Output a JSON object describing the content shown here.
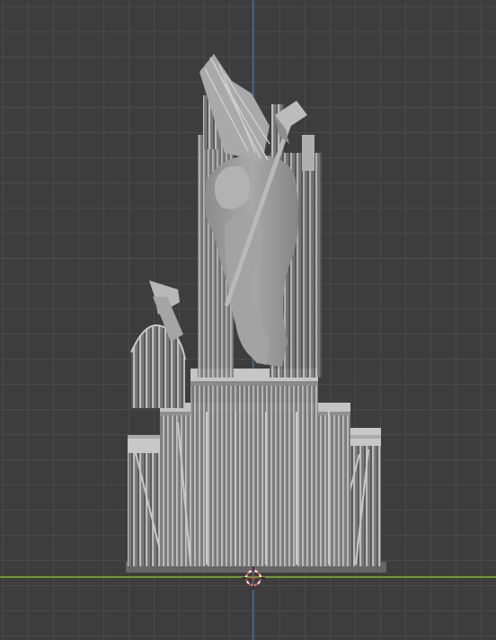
{
  "viewport": {
    "background_color": "#3d3d3d",
    "grid_color": "#4a4a4a",
    "axis_colors": {
      "y_axis": "#4f7fc6",
      "x_axis": "#6f9a2e"
    }
  },
  "scene": {
    "object": "sculpture-with-support-structures",
    "material_color": "#9a9a9a",
    "support_color": "#b5b5b5"
  },
  "cursor_icon": "3d-cursor-icon"
}
